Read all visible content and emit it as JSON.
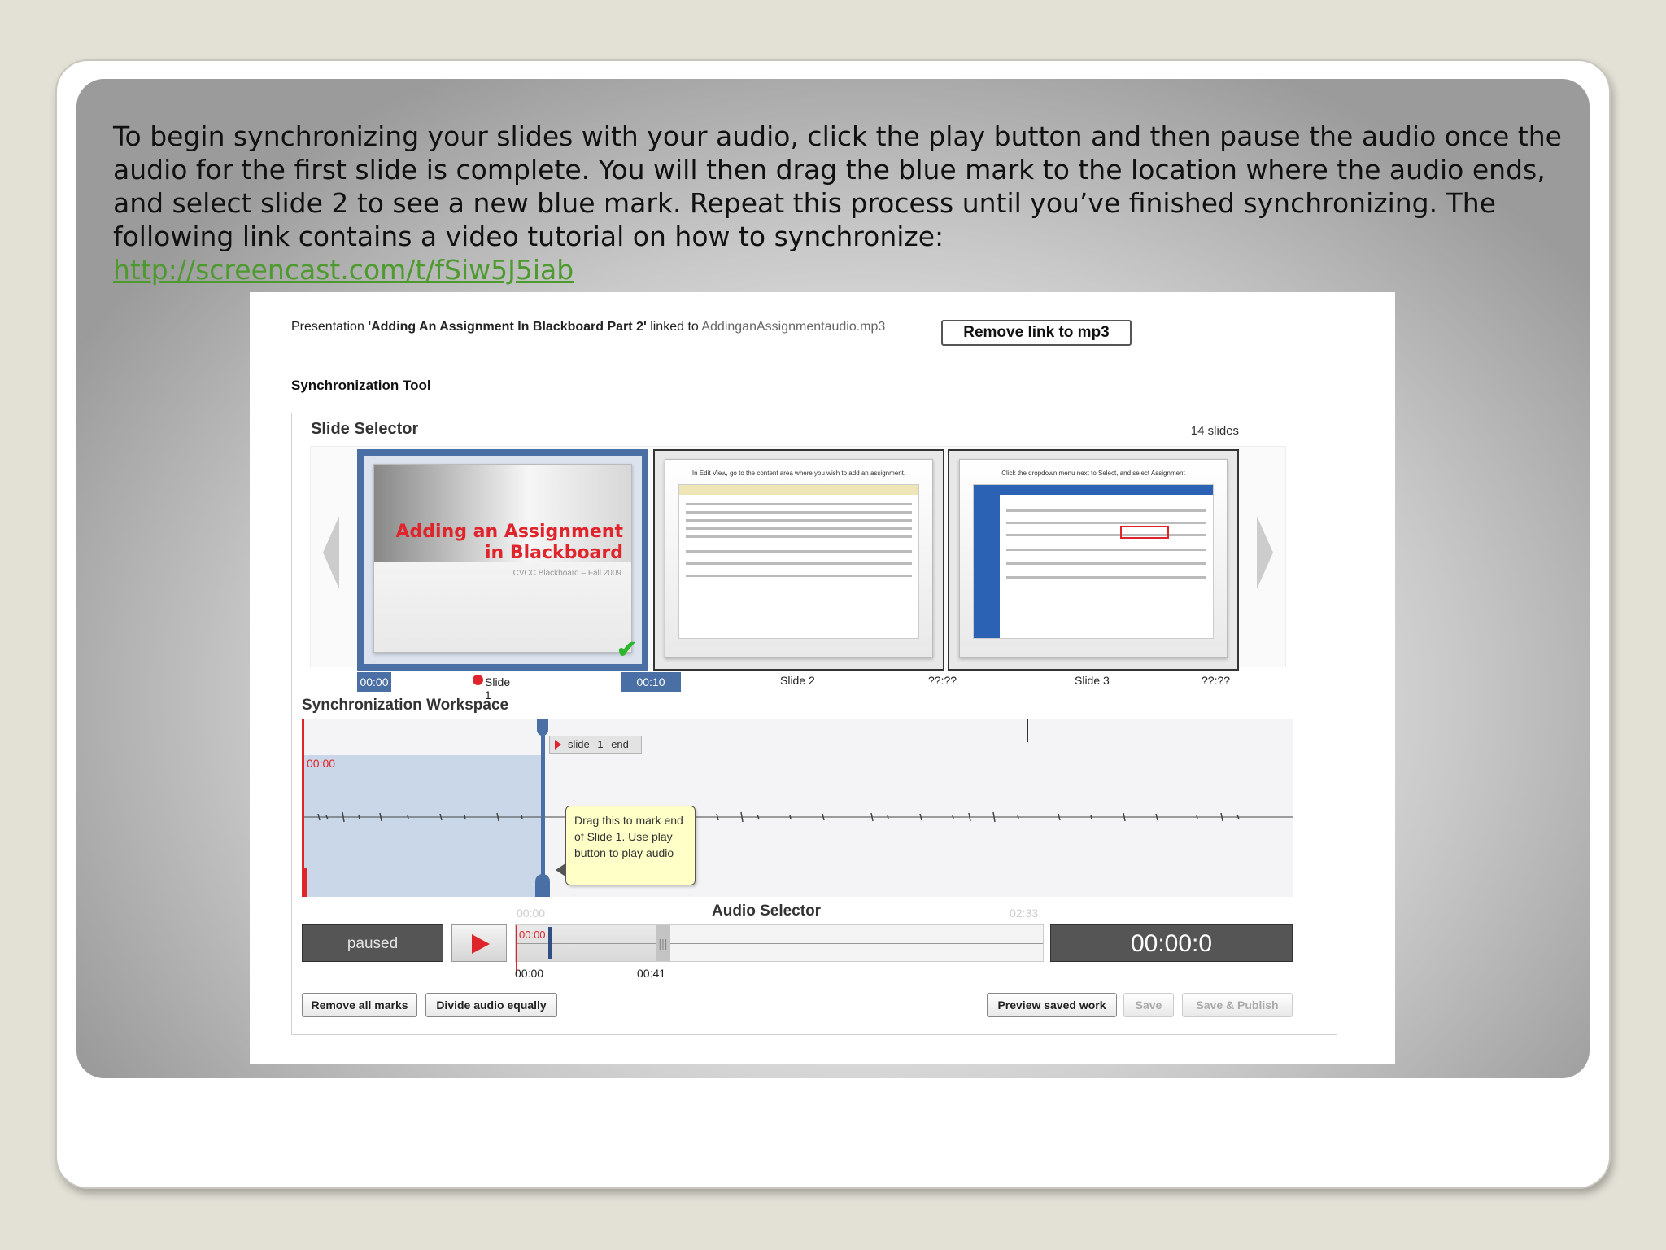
{
  "intro": {
    "text": "To begin synchronizing your slides with your audio, click the play button and then pause the audio once the audio for the first slide is complete.  You will then drag the blue mark to the location where the audio ends, and select slide 2 to see a new blue mark.  Repeat this process until you’ve finished synchronizing.  The following link contains a video tutorial on how to synchronize:",
    "link": "http://screencast.com/t/fSiw5J5iab"
  },
  "header": {
    "prefix": "Presentation ",
    "presentation_name": "'Adding An Assignment In Blackboard Part 2'",
    "linked_to": " linked to ",
    "mp3_file": "AddinganAssignmentaudio.mp3",
    "remove_link_button": "Remove link to mp3"
  },
  "sync_tool": {
    "title": "Synchronization Tool"
  },
  "slide_selector": {
    "title": "Slide Selector",
    "count": "14 slides",
    "slides": [
      {
        "label": "Slide 1",
        "start": "00:00",
        "end": "00:10",
        "title_line1": "Adding an Assignment",
        "title_line2": "in Blackboard",
        "subtitle": "CVCC Blackboard – Fall 2009",
        "selected": true
      },
      {
        "label": "Slide 2",
        "end": "??:??",
        "caption": "In Edit View, go to the content area where you wish to add an assignment."
      },
      {
        "label": "Slide 3",
        "end": "??:??",
        "caption": "Click the dropdown menu next to Select, and select Assignment"
      }
    ]
  },
  "workspace": {
    "title": "Synchronization Workspace",
    "start_time": "00:00",
    "mark_label": "slide 1 end",
    "tooltip": "Drag this to mark end of Slide 1. Use play button to play audio"
  },
  "audio_selector": {
    "title": "Audio Selector",
    "range_start": "00:00",
    "range_end": "02:33",
    "status": "paused",
    "track_time": "00:00",
    "timeline_start": "00:00",
    "timeline_mark": "00:41",
    "clock": "00:00:0"
  },
  "buttons": {
    "remove_all_marks": "Remove all marks",
    "divide_audio_equally": "Divide audio equally",
    "preview_saved_work": "Preview saved work",
    "save": "Save",
    "save_publish": "Save & Publish"
  }
}
